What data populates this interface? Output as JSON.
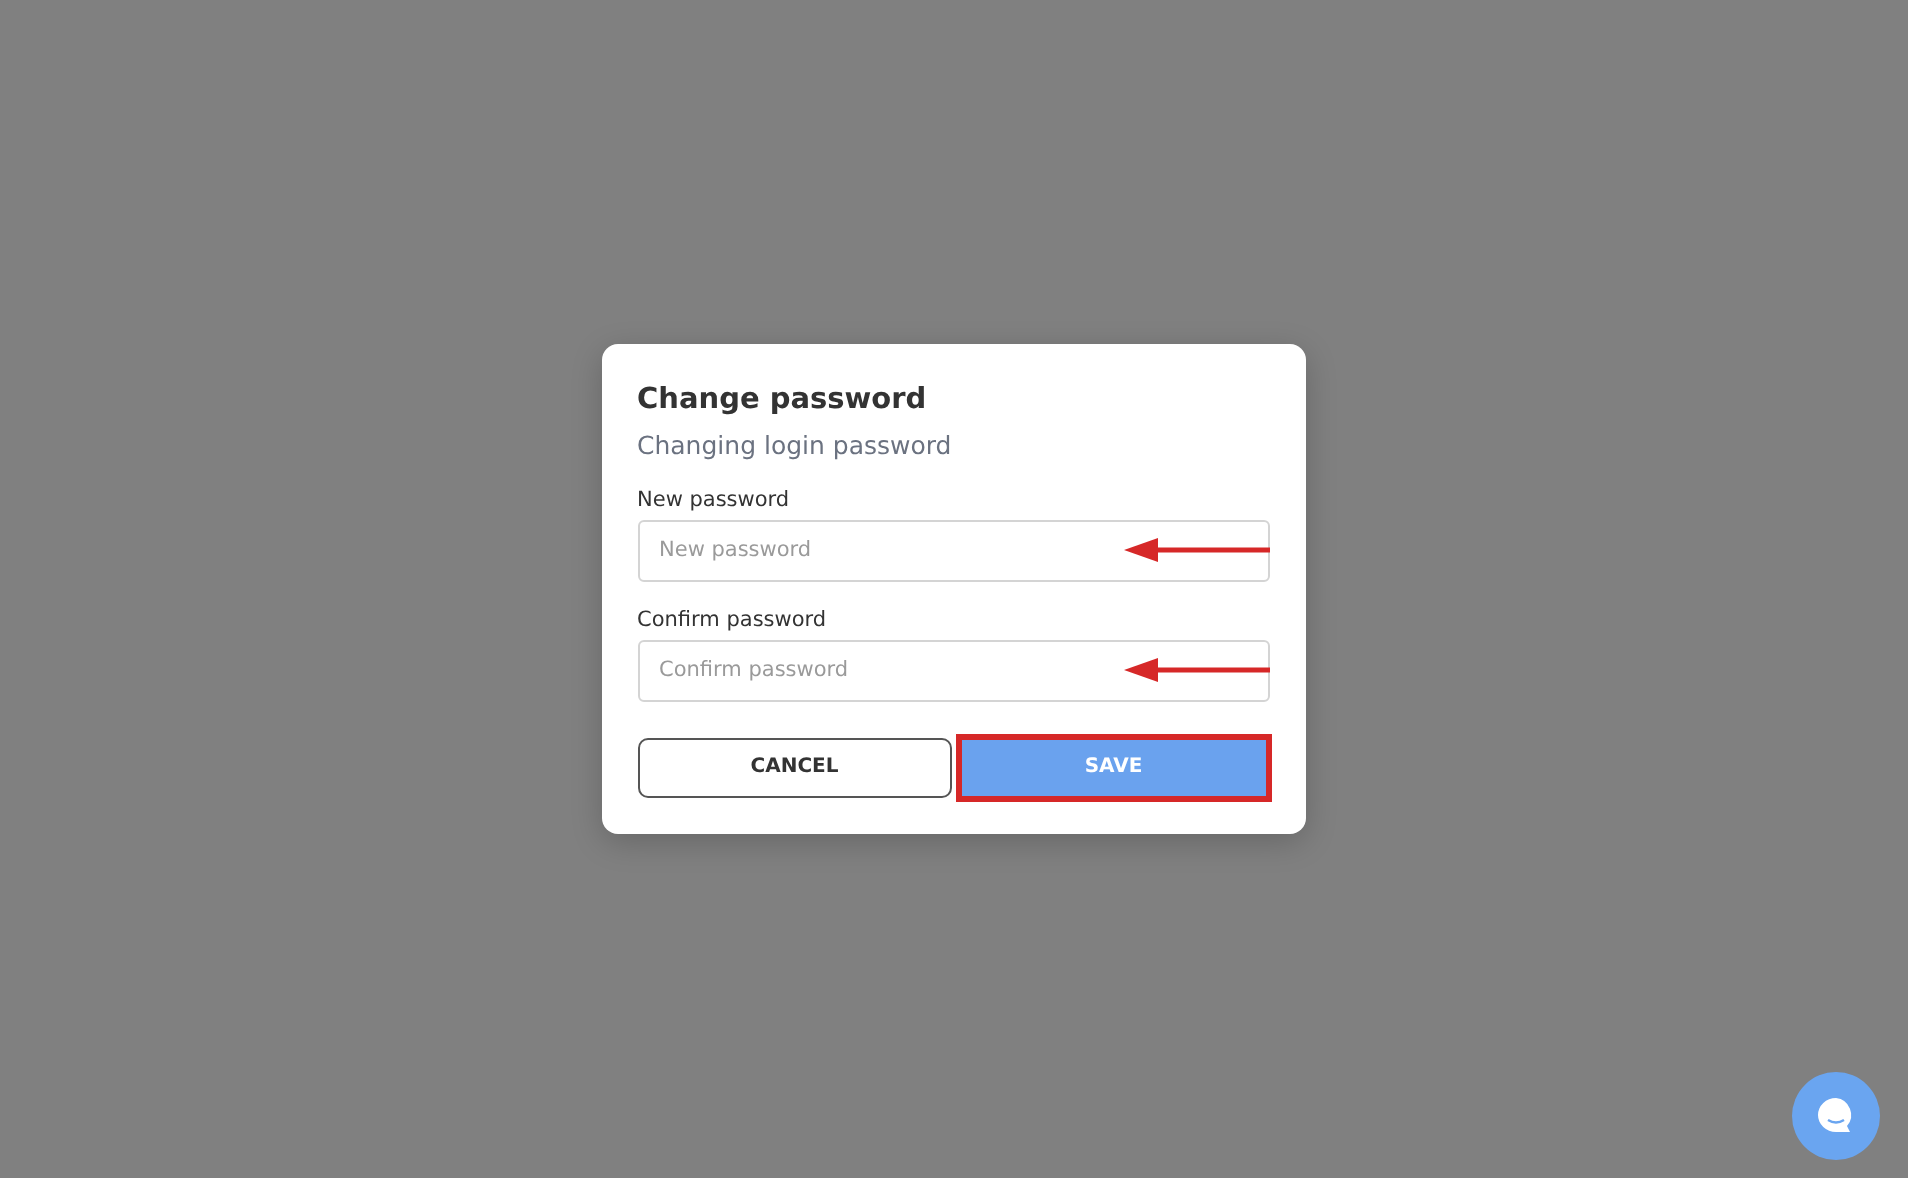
{
  "dialog": {
    "title": "Change password",
    "subtitle": "Changing login password",
    "fields": [
      {
        "label": "New password",
        "placeholder": "New password",
        "highlighted": true
      },
      {
        "label": "Confirm password",
        "placeholder": "Confirm password",
        "highlighted": true
      }
    ],
    "buttons": [
      {
        "label": "CANCEL",
        "kind": "secondary",
        "highlighted": false
      },
      {
        "label": "SAVE",
        "kind": "primary",
        "highlighted": true
      }
    ]
  },
  "chat_widget": {
    "visible": true
  }
}
